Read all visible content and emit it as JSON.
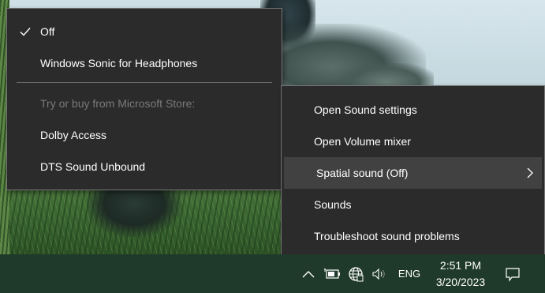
{
  "spatial_menu": {
    "items": [
      {
        "label": "Off",
        "checked": true
      },
      {
        "label": "Windows Sonic for Headphones",
        "checked": false
      }
    ],
    "store_label": "Try or buy from Microsoft Store:",
    "store_items": [
      {
        "label": "Dolby Access"
      },
      {
        "label": "DTS Sound Unbound"
      }
    ]
  },
  "sound_menu": {
    "items": [
      {
        "label": "Open Sound settings"
      },
      {
        "label": "Open Volume mixer"
      },
      {
        "label": "Spatial sound (Off)",
        "highlighted": true,
        "has_submenu": true
      },
      {
        "label": "Sounds"
      },
      {
        "label": "Troubleshoot sound problems"
      }
    ]
  },
  "taskbar": {
    "language": "ENG",
    "time": "2:51 PM",
    "date": "3/20/2023",
    "icons": [
      "chevron-up-icon",
      "battery-charging-icon",
      "network-globe-icon",
      "speaker-icon",
      "action-center-icon"
    ]
  }
}
